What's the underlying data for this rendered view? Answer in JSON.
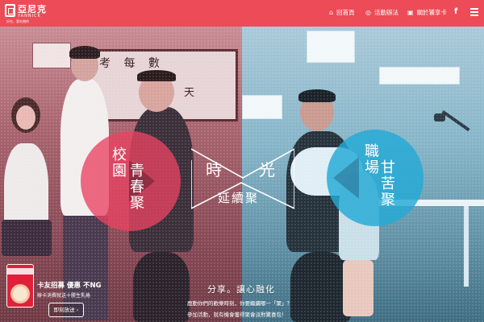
{
  "header": {
    "logo": {
      "name": "亞尼克",
      "sub": "YANNICK",
      "tagline": "好吃，要吃飽的"
    },
    "nav": [
      {
        "icon": "home-icon",
        "label": "回首頁"
      },
      {
        "icon": "info-icon",
        "label": "活動辦法"
      },
      {
        "icon": "card-icon",
        "label": "關於饕享卡"
      }
    ],
    "facebook": "f"
  },
  "scene": {
    "board_text": "考 每 數",
    "board_text2": "天",
    "center_title": {
      "a": "時",
      "b": "光",
      "sub": "延續聚"
    },
    "left_circle": {
      "line1": "校園",
      "line2": "青春聚"
    },
    "right_circle": {
      "line1": "職場",
      "line2": "甘苦聚"
    }
  },
  "content": {
    "tagline": "分享。讓心融化",
    "desc1": "鹿動你們的歡樂時刻，你要繼續哪一「聚」？",
    "desc2": "參加活動，就有機會獲得聚會派對驚喜包！"
  },
  "promo": {
    "title_a": "卡友招募 優惠",
    "title_b": "不NG",
    "sub": "辦卡消費就送十勝生乳捲",
    "button": "即刻放送 ›"
  },
  "colors": {
    "header": "#ec4b57",
    "left_circle": "#e94361",
    "right_circle": "#23aad6"
  }
}
